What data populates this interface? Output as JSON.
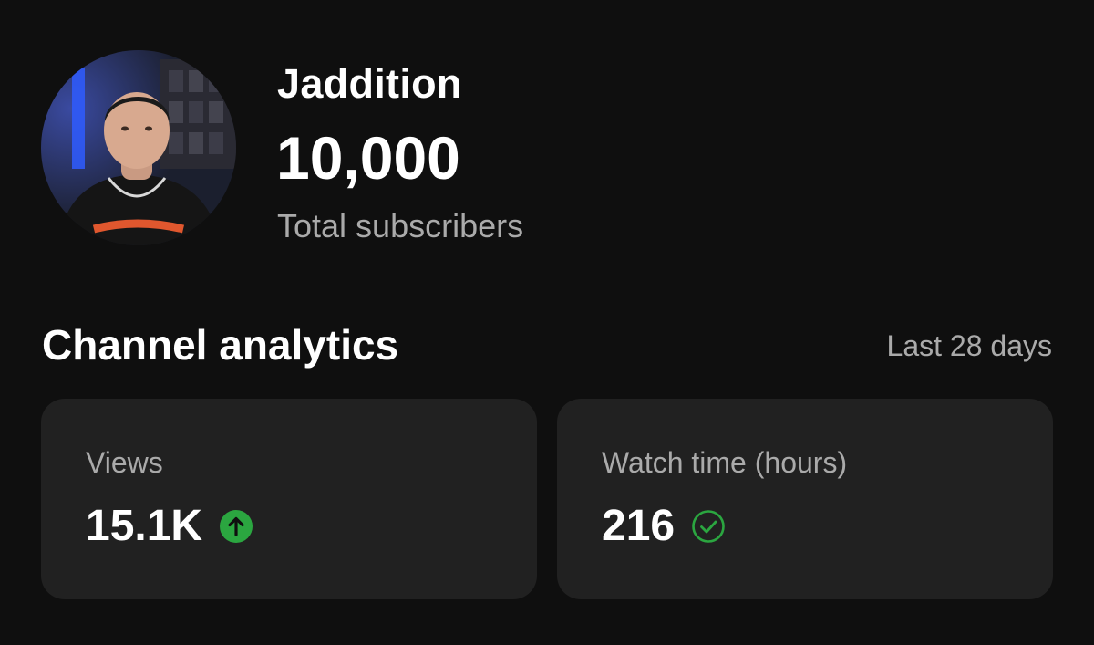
{
  "channel": {
    "name": "Jaddition",
    "subscriber_count": "10,000",
    "subscriber_label": "Total subscribers"
  },
  "analytics": {
    "title": "Channel analytics",
    "period": "Last 28 days",
    "cards": [
      {
        "label": "Views",
        "value": "15.1K",
        "icon": "arrow-up-circle-icon",
        "icon_color": "#2ba640"
      },
      {
        "label": "Watch time (hours)",
        "value": "216",
        "icon": "check-circle-icon",
        "icon_color": "#2ba640"
      }
    ]
  },
  "colors": {
    "background": "#0f0f0f",
    "card": "#212121",
    "primary_text": "#ffffff",
    "secondary_text": "#aaaaaa",
    "positive": "#2ba640"
  }
}
